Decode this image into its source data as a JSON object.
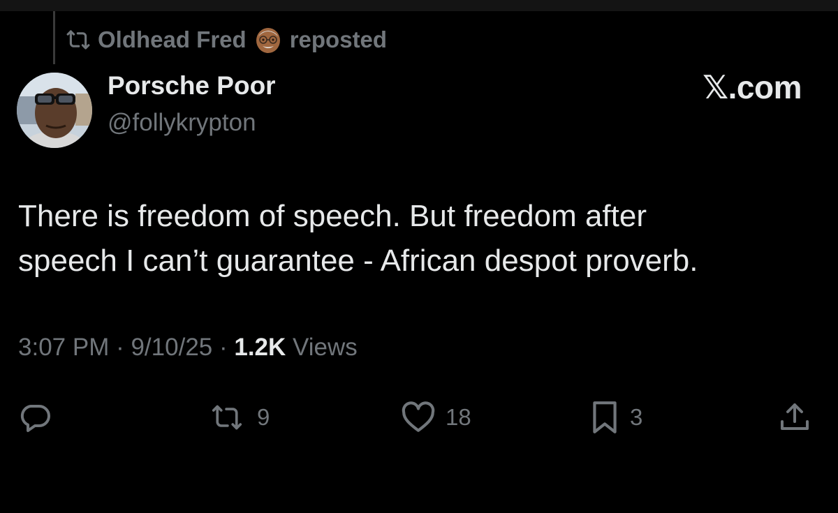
{
  "repost_bar": {
    "reposter_name": "Oldhead Fred",
    "action_label": "reposted",
    "icon": "repost-icon",
    "emoji": "older-man-emoji"
  },
  "author": {
    "display_name": "Porsche Poor",
    "handle": "@follykrypton",
    "avatar": "profile-photo"
  },
  "brand": {
    "label": "𝕏.com"
  },
  "tweet": {
    "text_line_1": "There is freedom of speech. But freedom after",
    "text_line_2": "speech I can’t guarantee - African despot proverb."
  },
  "meta": {
    "time": "3:07 PM",
    "separator": " · ",
    "date": "9/10/25",
    "views_count": "1.2K",
    "views_label": " Views"
  },
  "actions": {
    "reply": {
      "icon": "reply-icon",
      "count": ""
    },
    "repost": {
      "icon": "repost-icon",
      "count": "9"
    },
    "like": {
      "icon": "heart-icon",
      "count": "18"
    },
    "bookmark": {
      "icon": "bookmark-icon",
      "count": "3"
    },
    "share": {
      "icon": "share-icon",
      "count": ""
    }
  },
  "colors": {
    "background": "#000000",
    "primary_text": "#e7e9ea",
    "secondary_text": "#71767b"
  }
}
